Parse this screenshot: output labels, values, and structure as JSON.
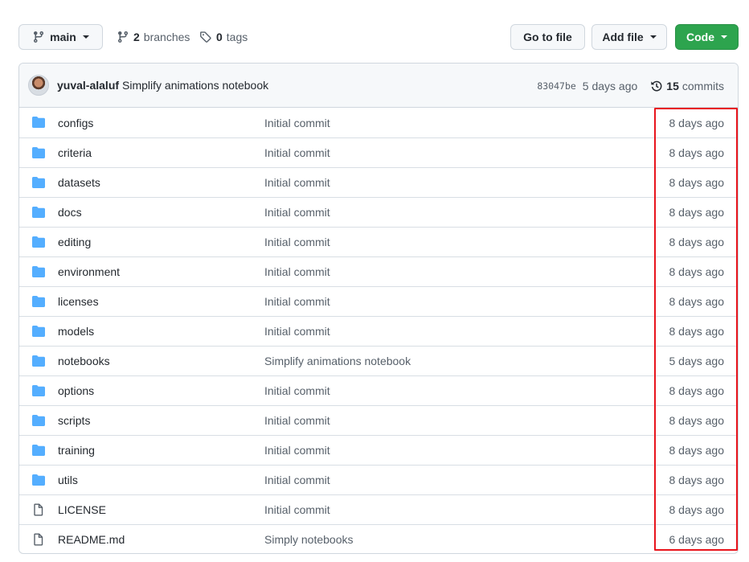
{
  "toolbar": {
    "branch_label": "main",
    "branches_count": "2",
    "branches_label": "branches",
    "tags_count": "0",
    "tags_label": "tags",
    "goto_file_label": "Go to file",
    "add_file_label": "Add file",
    "code_label": "Code",
    "code_color": "#2da44e"
  },
  "latest_commit": {
    "author": "yuval-alaluf",
    "message": "Simplify animations notebook",
    "sha": "83047be",
    "date": "5 days ago",
    "commits_count": "15",
    "commits_label": "commits"
  },
  "files": [
    {
      "type": "dir",
      "icon": "folder-icon",
      "name": "configs",
      "message": "Initial commit",
      "age": "8 days ago"
    },
    {
      "type": "dir",
      "icon": "folder-icon",
      "name": "criteria",
      "message": "Initial commit",
      "age": "8 days ago"
    },
    {
      "type": "dir",
      "icon": "folder-icon",
      "name": "datasets",
      "message": "Initial commit",
      "age": "8 days ago"
    },
    {
      "type": "dir",
      "icon": "folder-icon",
      "name": "docs",
      "message": "Initial commit",
      "age": "8 days ago"
    },
    {
      "type": "dir",
      "icon": "folder-icon",
      "name": "editing",
      "message": "Initial commit",
      "age": "8 days ago"
    },
    {
      "type": "dir",
      "icon": "folder-icon",
      "name": "environment",
      "message": "Initial commit",
      "age": "8 days ago"
    },
    {
      "type": "dir",
      "icon": "folder-icon",
      "name": "licenses",
      "message": "Initial commit",
      "age": "8 days ago"
    },
    {
      "type": "dir",
      "icon": "folder-icon",
      "name": "models",
      "message": "Initial commit",
      "age": "8 days ago"
    },
    {
      "type": "dir",
      "icon": "folder-icon",
      "name": "notebooks",
      "message": "Simplify animations notebook",
      "age": "5 days ago"
    },
    {
      "type": "dir",
      "icon": "folder-icon",
      "name": "options",
      "message": "Initial commit",
      "age": "8 days ago"
    },
    {
      "type": "dir",
      "icon": "folder-icon",
      "name": "scripts",
      "message": "Initial commit",
      "age": "8 days ago"
    },
    {
      "type": "dir",
      "icon": "folder-icon",
      "name": "training",
      "message": "Initial commit",
      "age": "8 days ago"
    },
    {
      "type": "dir",
      "icon": "folder-icon",
      "name": "utils",
      "message": "Initial commit",
      "age": "8 days ago"
    },
    {
      "type": "file",
      "icon": "file-icon",
      "name": "LICENSE",
      "message": "Initial commit",
      "age": "8 days ago"
    },
    {
      "type": "file",
      "icon": "file-icon",
      "name": "README.md",
      "message": "Simply notebooks",
      "age": "6 days ago"
    }
  ],
  "colors": {
    "folder": "#54aeff",
    "highlight_box": "#e8141c"
  }
}
